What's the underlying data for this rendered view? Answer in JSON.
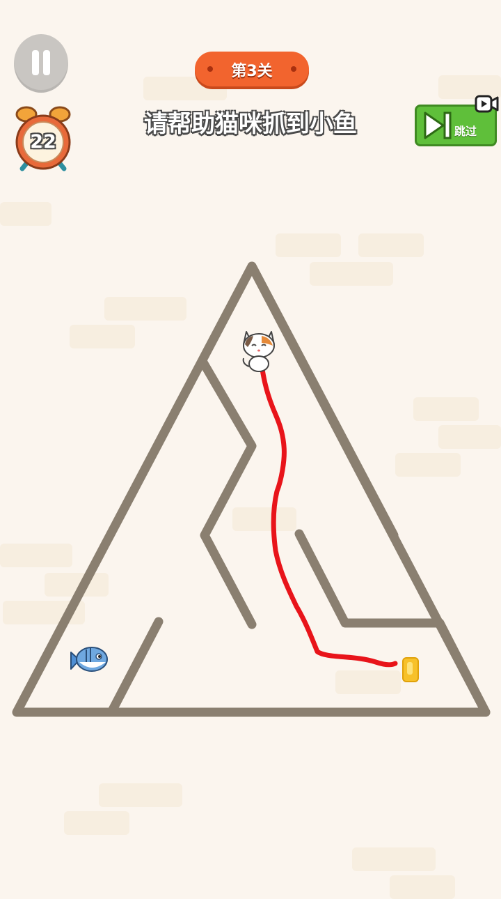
{
  "level": {
    "label": "第3关"
  },
  "instruction": "请帮助猫咪抓到小鱼",
  "timer": {
    "value": "22"
  },
  "skip_button": {
    "label": "跳过"
  },
  "icons": {
    "pause": "pause-icon",
    "alarm": "alarm-clock-icon",
    "skip": "skip-forward-icon",
    "video": "video-ad-icon",
    "cat": "cat-icon",
    "fish": "fish-icon",
    "obstacle": "golden-cup-icon"
  },
  "colors": {
    "background": "#fbf5ee",
    "maze_wall": "#8a7f70",
    "drawn_path": "#e8141a",
    "level_pill": "#f2642e",
    "skip_button": "#5fbf3a",
    "fish": "#4f8fd4"
  }
}
